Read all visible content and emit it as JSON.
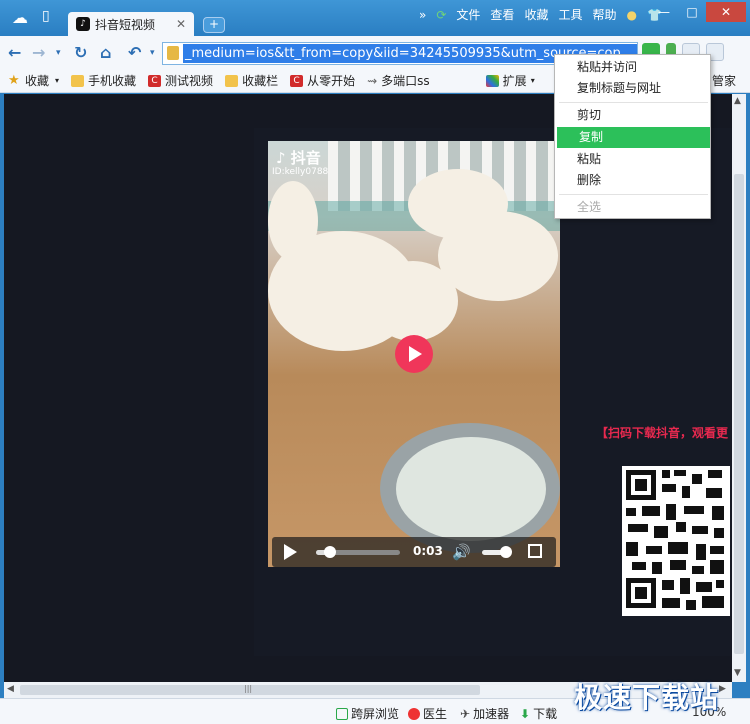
{
  "browser": {
    "tab_title": "抖音短视频",
    "new_tab_label": "+",
    "menu": [
      "文件",
      "查看",
      "收藏",
      "工具",
      "帮助"
    ],
    "window_buttons": [
      "—",
      "□",
      "✕"
    ]
  },
  "address_bar": {
    "url": "_medium=ios&tt_from=copy&iid=34245509935&utm_source=cop"
  },
  "favorites": [
    {
      "label": "收藏",
      "icon": "star-icon"
    },
    {
      "label": "手机收藏",
      "icon": "folder-icon"
    },
    {
      "label": "测试视频",
      "icon": "c-icon"
    },
    {
      "label": "收藏栏",
      "icon": "folder-icon"
    },
    {
      "label": "从零开始",
      "icon": "c-icon"
    },
    {
      "label": "多端口ss",
      "icon": "link-icon"
    },
    {
      "label": "扩展",
      "icon": "extension-icon"
    },
    {
      "label": "管家",
      "icon": "shield-icon"
    }
  ],
  "video": {
    "brand": "抖音",
    "user_id": "ID:kelly0788",
    "time": "0:03",
    "progress": 0.18
  },
  "promo": {
    "text": "【扫码下载抖音，观看更"
  },
  "context_menu": {
    "items": [
      {
        "label": "粘贴并访问",
        "state": "normal"
      },
      {
        "label": "复制标题与网址",
        "state": "normal"
      },
      {
        "label": "剪切",
        "state": "normal"
      },
      {
        "label": "复制",
        "state": "active"
      },
      {
        "label": "粘贴",
        "state": "normal"
      },
      {
        "label": "删除",
        "state": "normal"
      },
      {
        "label": "全选",
        "state": "disabled"
      }
    ]
  },
  "statusbar": {
    "items": [
      "跨屏浏览",
      "医生",
      "加速器",
      "下载"
    ],
    "zoom": "100%"
  },
  "watermark": "极速下载站",
  "colors": {
    "chrome_blue": "#2d7fc1",
    "url_highlight": "#2f7ee8",
    "menu_active": "#2cc05a",
    "promo_red": "#e8294f",
    "play_button": "#f0365a"
  }
}
